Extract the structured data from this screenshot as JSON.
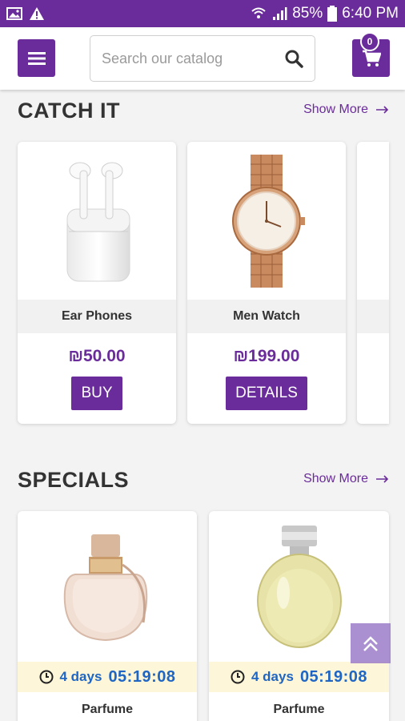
{
  "status_bar": {
    "battery": "85%",
    "time": "6:40 PM"
  },
  "search": {
    "placeholder": "Search our catalog"
  },
  "cart": {
    "count": "0"
  },
  "catch_it": {
    "title": "CATCH IT",
    "show_more": "Show More",
    "products": [
      {
        "name": "Ear Phones",
        "price": "₪50.00",
        "action": "BUY"
      },
      {
        "name": "Men Watch",
        "price": "₪199.00",
        "action": "DETAILS"
      }
    ]
  },
  "specials": {
    "title": "SPECIALS",
    "show_more": "Show More",
    "products": [
      {
        "days": "4 days",
        "time": "05:19:08",
        "name": "Parfume"
      },
      {
        "days": "4 days",
        "time": "05:19:08",
        "name": "Parfume"
      }
    ]
  },
  "colors": {
    "brand": "#6a2c9a",
    "timer_text": "#1f66c4",
    "timer_bg": "#fdf6d8"
  }
}
